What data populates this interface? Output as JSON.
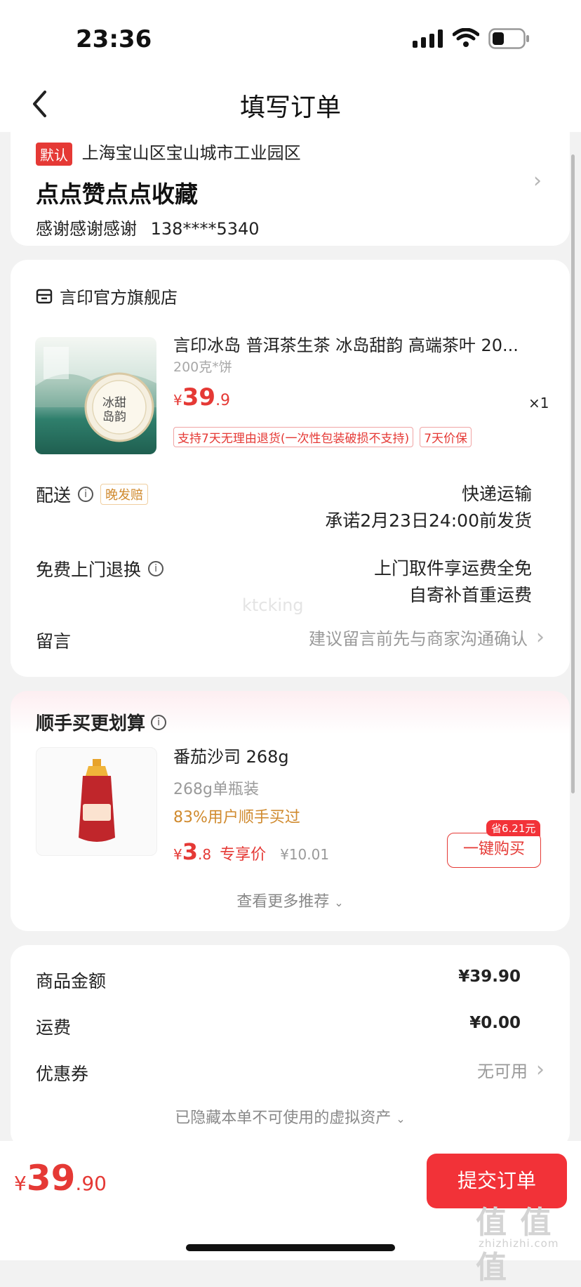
{
  "status_bar": {
    "time": "23:36"
  },
  "header": {
    "title": "填写订单"
  },
  "address": {
    "default_tag": "默认",
    "location": "上海宝山区宝山城市工业园区",
    "detail": "点点赞点点收藏",
    "recipient_name": "感谢感谢感谢",
    "phone": "138****5340"
  },
  "store": {
    "name": "言印官方旗舰店"
  },
  "product": {
    "title": "言印冰岛 普洱茶生茶 冰岛甜韵 高端茶叶 20...",
    "spec": "200克*饼",
    "price_symbol": "¥",
    "price_int": "39",
    "price_dec": ".9",
    "quantity": "×1",
    "tag_return": "支持7天无理由退货(一次性包装破损不支持)",
    "tag_price_protect": "7天价保",
    "image_text_1": "冰甜",
    "image_text_2": "岛韵"
  },
  "delivery": {
    "label": "配送",
    "late_tag": "晚发赔",
    "method": "快递运输",
    "promise": "承诺2月23日24:00前发货"
  },
  "return_service": {
    "label": "免费上门退换",
    "line1": "上门取件享运费全免",
    "line2": "自寄补首重运费"
  },
  "message": {
    "label": "留言",
    "placeholder": "建议留言前先与商家沟通确认"
  },
  "watermark_text": "ktcking",
  "recommend": {
    "title": "顺手买更划算",
    "item_name": "番茄沙司 268g",
    "item_spec": "268g单瓶装",
    "item_social": "83%用户顺手买过",
    "price_symbol": "¥",
    "price_int": "3",
    "price_dec": ".8",
    "price_label": "专享价",
    "original_price": "¥10.01",
    "save_badge": "省6.21元",
    "buy_button": "一键购买",
    "more": "查看更多推荐"
  },
  "summary": {
    "goods_label": "商品金额",
    "goods_value": "¥39.90",
    "shipping_label": "运费",
    "shipping_value": "¥0.00",
    "coupon_label": "优惠券",
    "coupon_value": "无可用",
    "hidden_assets": "已隐藏本单不可使用的虚拟资产"
  },
  "footer": {
    "total_symbol": "¥",
    "total_int": "39",
    "total_dec": ".90",
    "submit_label": "提交订单"
  },
  "site_watermark": {
    "main": "值 值 值",
    "sub": "zhizhizhi.com"
  },
  "colors": {
    "accent": "#e53935",
    "submit": "#f23238",
    "orange": "#d08a2e",
    "background": "#f2f2f2"
  }
}
